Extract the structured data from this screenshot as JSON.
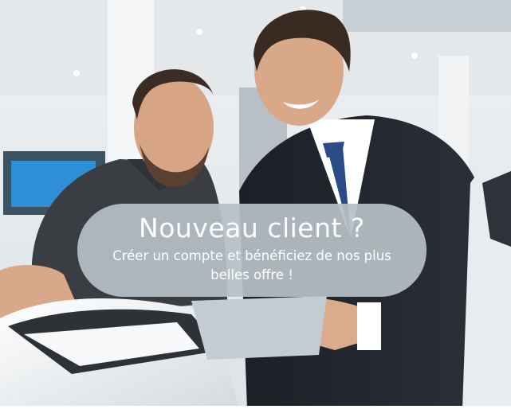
{
  "banner": {
    "photo_alt": "people-photo",
    "cta": {
      "title": "Nouveau client ?",
      "subtitle": "Créer un compte et bénéficiez de nos plus belles offre !"
    }
  },
  "colors": {
    "pill_bg": "#b6c0c6",
    "text": "#ffffff"
  }
}
